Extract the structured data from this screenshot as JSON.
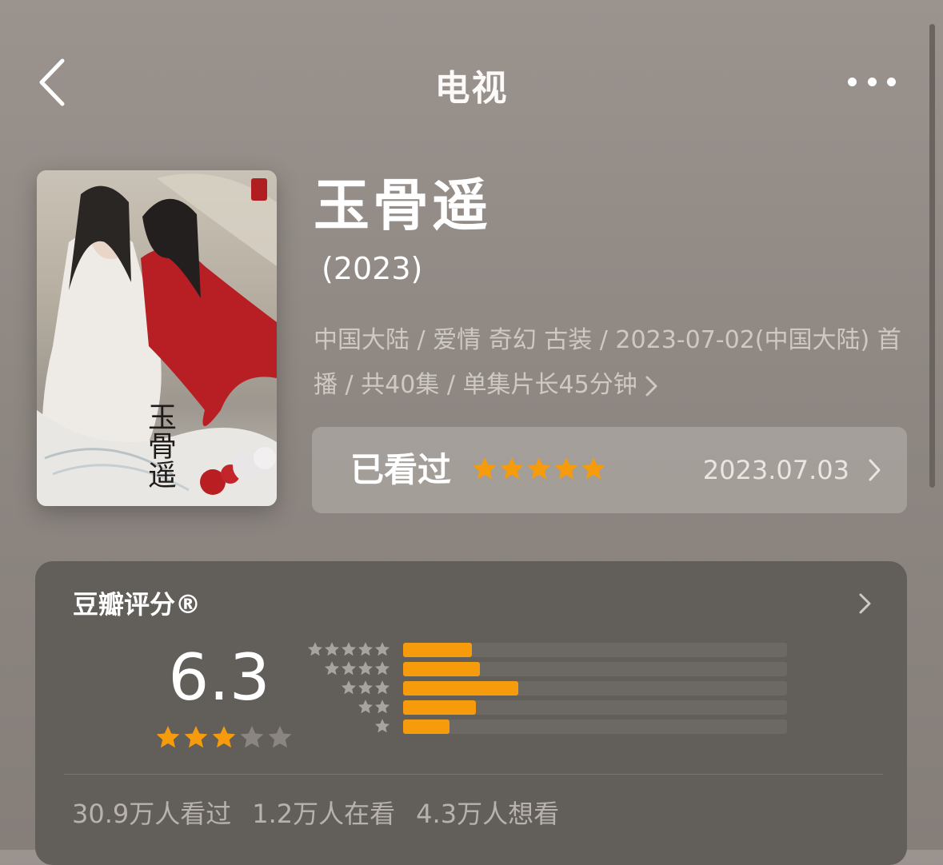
{
  "nav": {
    "title": "电视"
  },
  "show": {
    "title": "玉骨遥",
    "year": "(2023)",
    "meta": "中国大陆 / 爱情 奇幻 古装 / 2023-07-02(中国大陆) 首播 / 共40集 / 单集片长45分钟",
    "poster_calligraphy": "玉骨遥"
  },
  "watched": {
    "label": "已看过",
    "stars": 5,
    "date": "2023.07.03"
  },
  "rating": {
    "title": "豆瓣评分®",
    "score": "6.3",
    "score_stars": 3,
    "distribution": [
      {
        "stars": 5,
        "fraction": 0.18
      },
      {
        "stars": 4,
        "fraction": 0.2
      },
      {
        "stars": 3,
        "fraction": 0.3
      },
      {
        "stars": 2,
        "fraction": 0.19
      },
      {
        "stars": 1,
        "fraction": 0.12
      }
    ],
    "counts": [
      "30.9万人看过",
      "1.2万人在看",
      "4.3万人想看"
    ]
  },
  "colors": {
    "accent_star": "#f59b0c",
    "muted_star": "#8a8580",
    "card": "#625e59"
  }
}
